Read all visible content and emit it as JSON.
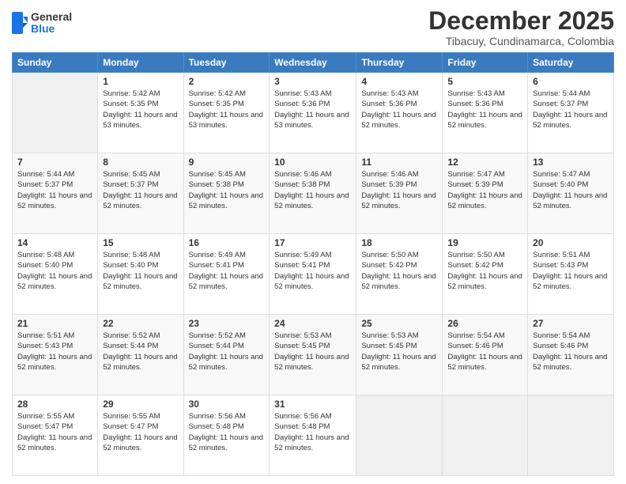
{
  "header": {
    "logo": {
      "line1": "General",
      "line2": "Blue"
    },
    "title": "December 2025",
    "location": "Tibacuy, Cundinamarca, Colombia"
  },
  "days_of_week": [
    "Sunday",
    "Monday",
    "Tuesday",
    "Wednesday",
    "Thursday",
    "Friday",
    "Saturday"
  ],
  "weeks": [
    [
      {
        "day": "",
        "info": ""
      },
      {
        "day": "1",
        "info": "Sunrise: 5:42 AM\nSunset: 5:35 PM\nDaylight: 11 hours\nand 53 minutes."
      },
      {
        "day": "2",
        "info": "Sunrise: 5:42 AM\nSunset: 5:35 PM\nDaylight: 11 hours\nand 53 minutes."
      },
      {
        "day": "3",
        "info": "Sunrise: 5:43 AM\nSunset: 5:36 PM\nDaylight: 11 hours\nand 53 minutes."
      },
      {
        "day": "4",
        "info": "Sunrise: 5:43 AM\nSunset: 5:36 PM\nDaylight: 11 hours\nand 52 minutes."
      },
      {
        "day": "5",
        "info": "Sunrise: 5:43 AM\nSunset: 5:36 PM\nDaylight: 11 hours\nand 52 minutes."
      },
      {
        "day": "6",
        "info": "Sunrise: 5:44 AM\nSunset: 5:37 PM\nDaylight: 11 hours\nand 52 minutes."
      }
    ],
    [
      {
        "day": "7",
        "info": "Sunrise: 5:44 AM\nSunset: 5:37 PM\nDaylight: 11 hours\nand 52 minutes."
      },
      {
        "day": "8",
        "info": "Sunrise: 5:45 AM\nSunset: 5:37 PM\nDaylight: 11 hours\nand 52 minutes."
      },
      {
        "day": "9",
        "info": "Sunrise: 5:45 AM\nSunset: 5:38 PM\nDaylight: 11 hours\nand 52 minutes."
      },
      {
        "day": "10",
        "info": "Sunrise: 5:46 AM\nSunset: 5:38 PM\nDaylight: 11 hours\nand 52 minutes."
      },
      {
        "day": "11",
        "info": "Sunrise: 5:46 AM\nSunset: 5:39 PM\nDaylight: 11 hours\nand 52 minutes."
      },
      {
        "day": "12",
        "info": "Sunrise: 5:47 AM\nSunset: 5:39 PM\nDaylight: 11 hours\nand 52 minutes."
      },
      {
        "day": "13",
        "info": "Sunrise: 5:47 AM\nSunset: 5:40 PM\nDaylight: 11 hours\nand 52 minutes."
      }
    ],
    [
      {
        "day": "14",
        "info": "Sunrise: 5:48 AM\nSunset: 5:40 PM\nDaylight: 11 hours\nand 52 minutes."
      },
      {
        "day": "15",
        "info": "Sunrise: 5:48 AM\nSunset: 5:40 PM\nDaylight: 11 hours\nand 52 minutes."
      },
      {
        "day": "16",
        "info": "Sunrise: 5:49 AM\nSunset: 5:41 PM\nDaylight: 11 hours\nand 52 minutes."
      },
      {
        "day": "17",
        "info": "Sunrise: 5:49 AM\nSunset: 5:41 PM\nDaylight: 11 hours\nand 52 minutes."
      },
      {
        "day": "18",
        "info": "Sunrise: 5:50 AM\nSunset: 5:42 PM\nDaylight: 11 hours\nand 52 minutes."
      },
      {
        "day": "19",
        "info": "Sunrise: 5:50 AM\nSunset: 5:42 PM\nDaylight: 11 hours\nand 52 minutes."
      },
      {
        "day": "20",
        "info": "Sunrise: 5:51 AM\nSunset: 5:43 PM\nDaylight: 11 hours\nand 52 minutes."
      }
    ],
    [
      {
        "day": "21",
        "info": "Sunrise: 5:51 AM\nSunset: 5:43 PM\nDaylight: 11 hours\nand 52 minutes."
      },
      {
        "day": "22",
        "info": "Sunrise: 5:52 AM\nSunset: 5:44 PM\nDaylight: 11 hours\nand 52 minutes."
      },
      {
        "day": "23",
        "info": "Sunrise: 5:52 AM\nSunset: 5:44 PM\nDaylight: 11 hours\nand 52 minutes."
      },
      {
        "day": "24",
        "info": "Sunrise: 5:53 AM\nSunset: 5:45 PM\nDaylight: 11 hours\nand 52 minutes."
      },
      {
        "day": "25",
        "info": "Sunrise: 5:53 AM\nSunset: 5:45 PM\nDaylight: 11 hours\nand 52 minutes."
      },
      {
        "day": "26",
        "info": "Sunrise: 5:54 AM\nSunset: 5:46 PM\nDaylight: 11 hours\nand 52 minutes."
      },
      {
        "day": "27",
        "info": "Sunrise: 5:54 AM\nSunset: 5:46 PM\nDaylight: 11 hours\nand 52 minutes."
      }
    ],
    [
      {
        "day": "28",
        "info": "Sunrise: 5:55 AM\nSunset: 5:47 PM\nDaylight: 11 hours\nand 52 minutes."
      },
      {
        "day": "29",
        "info": "Sunrise: 5:55 AM\nSunset: 5:47 PM\nDaylight: 11 hours\nand 52 minutes."
      },
      {
        "day": "30",
        "info": "Sunrise: 5:56 AM\nSunset: 5:48 PM\nDaylight: 11 hours\nand 52 minutes."
      },
      {
        "day": "31",
        "info": "Sunrise: 5:56 AM\nSunset: 5:48 PM\nDaylight: 11 hours\nand 52 minutes."
      },
      {
        "day": "",
        "info": ""
      },
      {
        "day": "",
        "info": ""
      },
      {
        "day": "",
        "info": ""
      }
    ]
  ]
}
